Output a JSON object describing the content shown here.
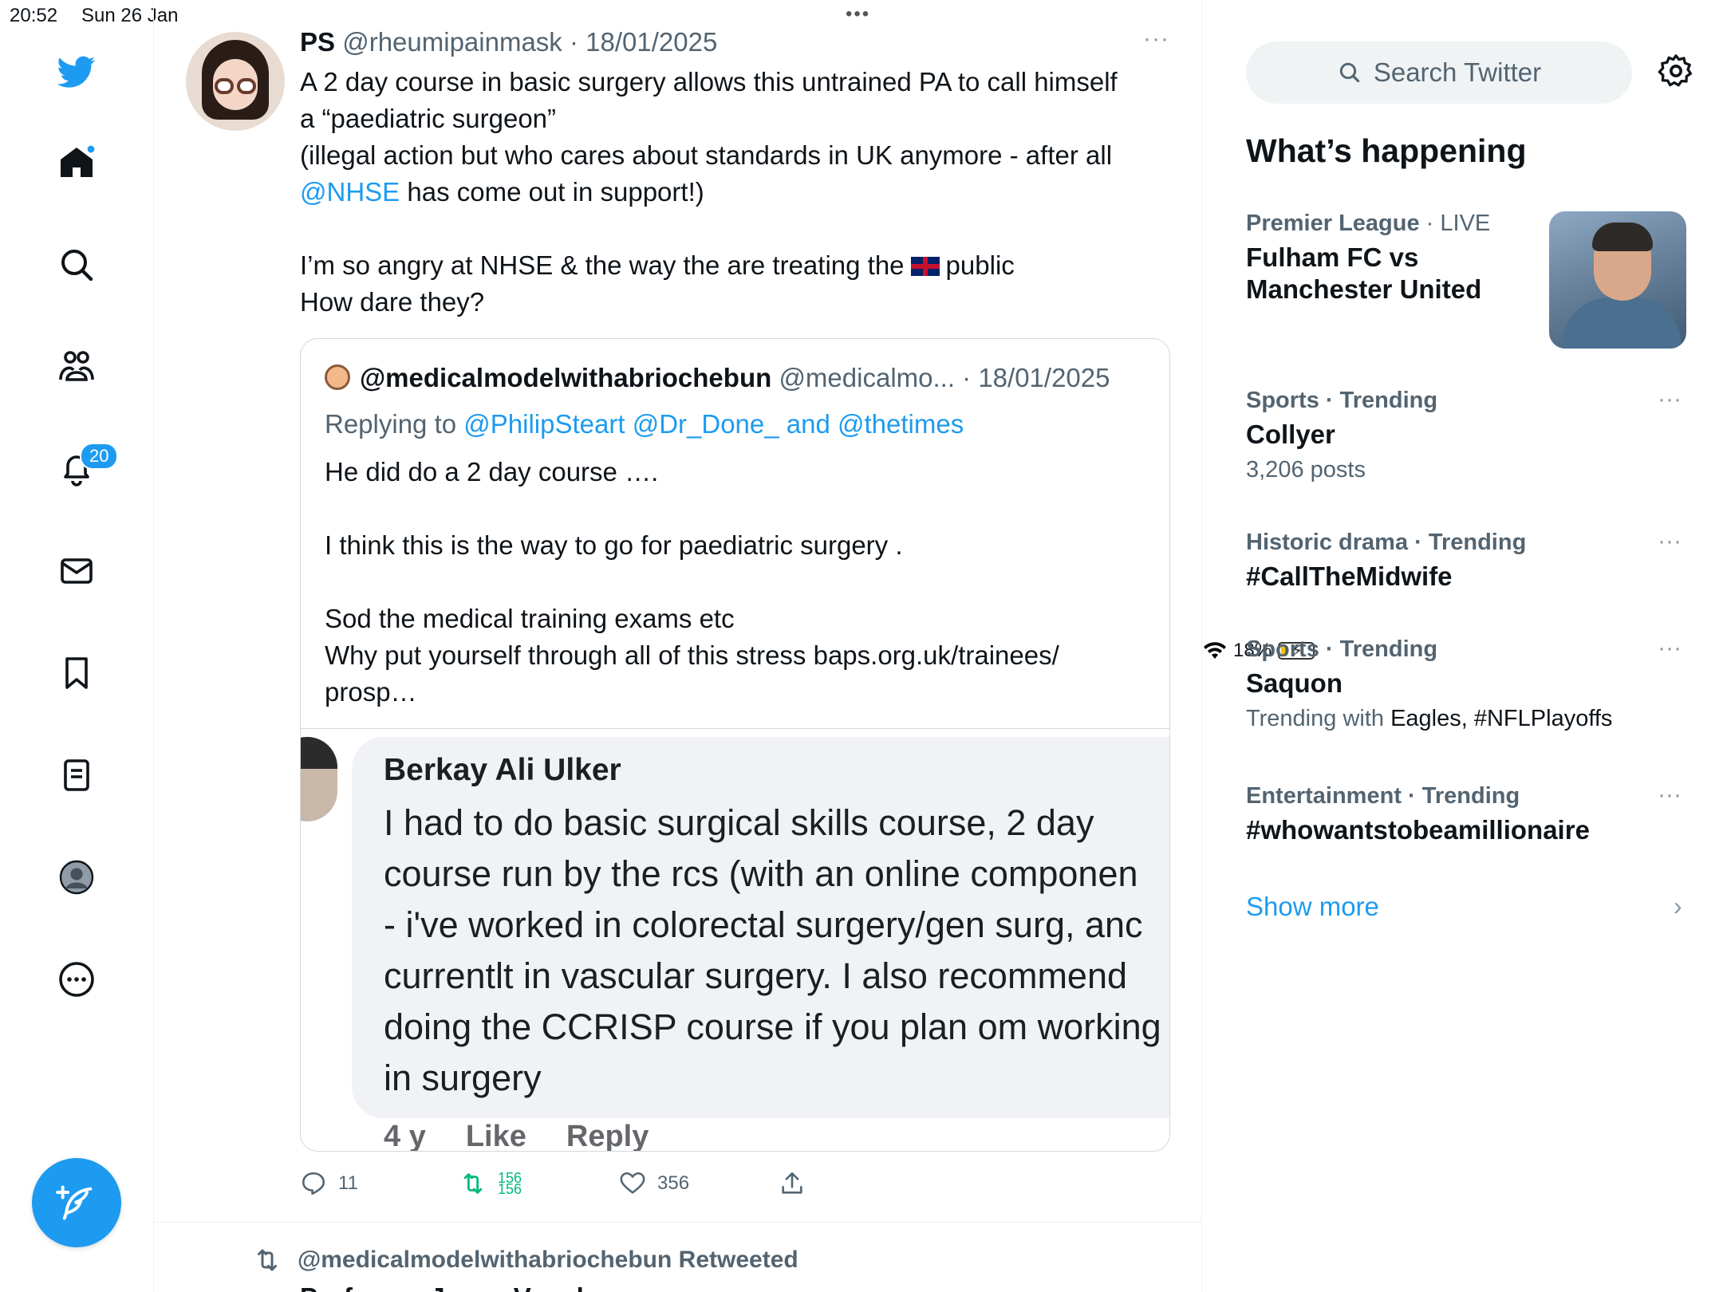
{
  "status_bar": {
    "time": "20:52",
    "date": "Sun 26 Jan",
    "battery": "18%",
    "multitask_dots": "•••"
  },
  "nav": {
    "items": [
      "twitter-logo",
      "home",
      "explore",
      "communities",
      "notifications",
      "messages",
      "bookmarks",
      "lists",
      "profile",
      "more"
    ],
    "notifications_badge": "20",
    "accent": "#1d9bf0"
  },
  "tweet": {
    "name": "PS",
    "handle": "@rheumipainmask",
    "date": "18/01/2025",
    "meta": "@rheumipainmask · 18/01/2025",
    "lines": [
      "A 2 day course in basic surgery allows this untrained PA to call himself",
      "a “paediatric surgeon”",
      "(illegal action but who cares about standards in UK anymore - after all",
      "has come out in support!)",
      "I’m so angry at NHSE & the way the are treating the",
      "public",
      "How dare they?"
    ],
    "mention": "@NHSE",
    "more": "···"
  },
  "quote": {
    "name": "@medicalmodelwithabriochebun",
    "meta": "@medicalmo... · 18/01/2025",
    "reply_prefix": "Replying to",
    "reply_to": "@PhilipSteart @Dr_Done_ and @thetimes",
    "body": [
      "He did do a 2 day course ….",
      "I think this is the way to go for paediatric surgery .",
      "Sod the medical training exams etc",
      "Why put yourself through all of this stress baps.org.uk/trainees/",
      "prosp…"
    ],
    "image": {
      "commenter": "Berkay Ali Ulker",
      "comment": [
        "I had to do basic surgical skills course, 2 day",
        "course run by the rcs (with an online componen",
        "- i've worked in colorectal surgery/gen surg, anc",
        "currentlt in vascular surgery. I also recommend",
        "doing the CCRISP course if you plan om working",
        "in surgery"
      ],
      "footer": [
        "4 y",
        "Like",
        "Reply"
      ]
    }
  },
  "actions": {
    "replies": "11",
    "retweets": [
      "156",
      "156"
    ],
    "likes": "356"
  },
  "retweet_line": "@medicalmodelwithabriochebun Retweeted",
  "next_tweet_peek": "Professor Jenny Vaughan",
  "sidebar": {
    "search_placeholder": "Search Twitter",
    "heading": "What’s happening",
    "trends": [
      {
        "category": "Premier League",
        "meta": "LIVE",
        "title_lines": [
          "Fulham FC vs",
          "Manchester United"
        ]
      },
      {
        "category": "Sports · Trending",
        "title": "Collyer",
        "sub": "3,206 posts"
      },
      {
        "category": "Historic drama · Trending",
        "title": "#CallTheMidwife"
      },
      {
        "category": "Sports · Trending",
        "title": "Saquon",
        "sub_prefix": "Trending with",
        "sub_items": "Eagles, #NFLPlayoffs"
      },
      {
        "category": "Entertainment · Trending",
        "title": "#whowantstobeamillionaire"
      }
    ],
    "show_more": "Show more"
  }
}
